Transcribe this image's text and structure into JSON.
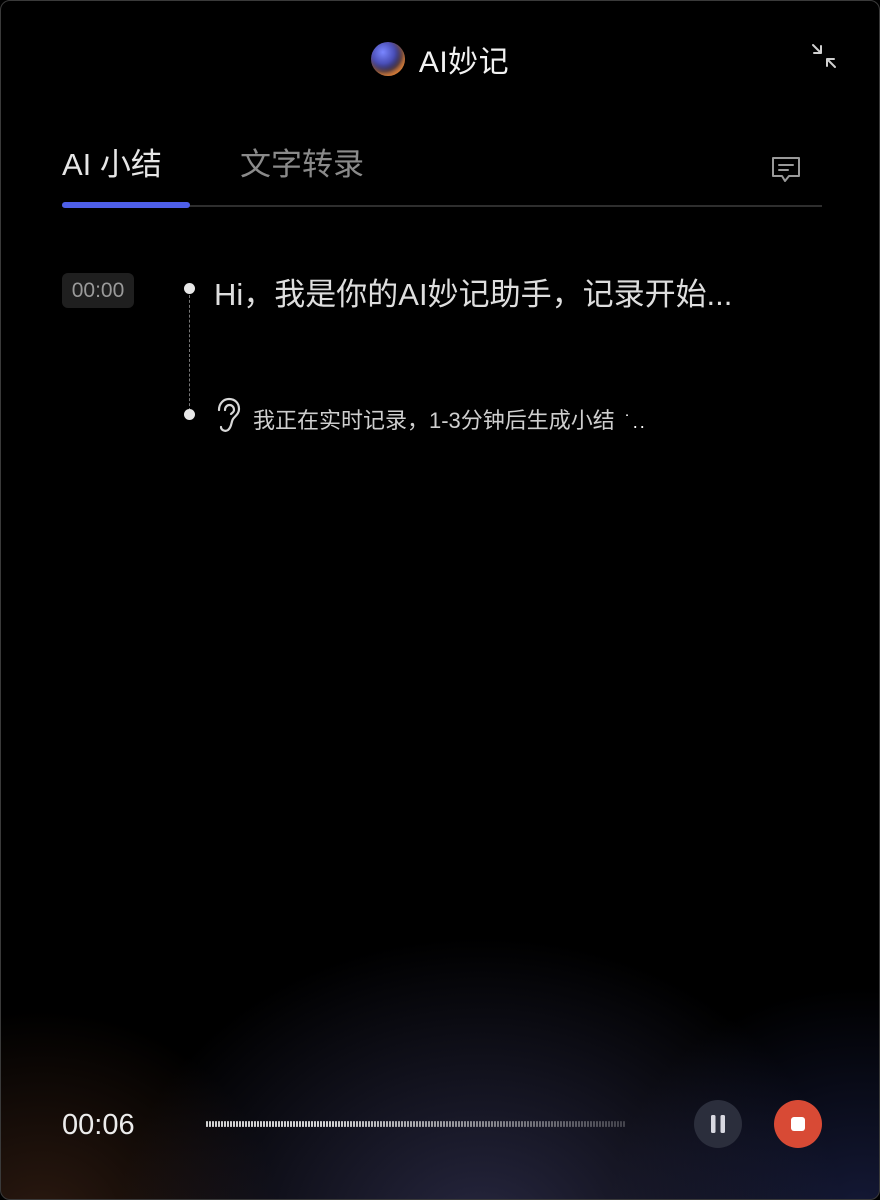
{
  "header": {
    "title": "AI妙记",
    "logo_icon": "ai-orb-logo",
    "collapse_icon": "collapse-arrows-icon"
  },
  "tabs": [
    {
      "label": "AI 小结",
      "active": true
    },
    {
      "label": "文字转录",
      "active": false
    }
  ],
  "tab_action_icon": "chat-comment-icon",
  "accent_color": "#4e5fe8",
  "timeline": {
    "timestamp": "00:00",
    "greeting": "Hi，我是你的AI妙记助手，记录开始...",
    "status_icon": "ear-icon",
    "status_text": "我正在实时记录，1-3分钟后生成小结"
  },
  "player": {
    "elapsed": "00:06",
    "pause_icon": "pause-icon",
    "stop_icon": "stop-icon",
    "stop_color": "#d84a35"
  }
}
